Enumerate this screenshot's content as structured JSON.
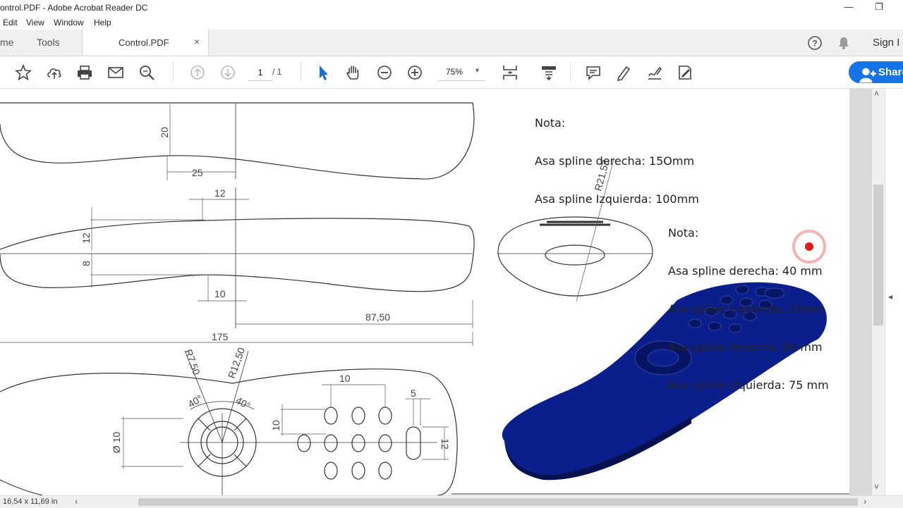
{
  "window": {
    "title": "ontrol.PDF - Adobe Acrobat Reader DC",
    "minimize_glyph": "—",
    "restore_glyph": "❐"
  },
  "menu": [
    "Edit",
    "View",
    "Window",
    "Help"
  ],
  "tabs": {
    "home": "me",
    "tools": "Tools",
    "document": "Control.PDF",
    "close_glyph": "×"
  },
  "header_right": {
    "sign_in": "Sign I"
  },
  "toolbar": {
    "page_current": "1",
    "page_total": "/ 1",
    "zoom": "75%",
    "zoom_caret": "▾",
    "share_label": "Share"
  },
  "icons": [
    "star-icon",
    "upload-cloud-icon",
    "print-icon",
    "mail-icon",
    "search-zoom-icon",
    "page-up-icon",
    "page-down-icon",
    "select-arrow-icon",
    "hand-icon",
    "zoom-out-icon",
    "zoom-in-icon",
    "fit-page-icon",
    "scroll-mode-icon",
    "comment-icon",
    "highlight-icon",
    "sign-icon",
    "edit-stamp-icon",
    "help-icon",
    "bell-icon",
    "add-user-icon"
  ],
  "drawing": {
    "note1": {
      "heading": "Nota:",
      "line1": "Asa spline derecha: 15Omm",
      "line2": "Asa spline Izquierda: 100mm"
    },
    "note2": {
      "heading": "Nota:",
      "line1": "Asa spline derecha: 40 mm",
      "line2": "Asa spline Izquierda: 20mm",
      "line3": "Asa spline derecha: 90 mm",
      "line4": "Asa spline Izquierda: 75 mm"
    },
    "dims": {
      "d20": "20",
      "d25": "25",
      "d12a": "12",
      "d12b": "12",
      "d8": "8",
      "d10a": "10",
      "d87": "87,50",
      "d175": "175",
      "r750": "R7,50",
      "r1250": "R12,50",
      "a40a": "40°",
      "a40b": "40°",
      "d10b": "10",
      "d5": "5",
      "d10c": "10",
      "d12c": "12",
      "dia10": "Ø 10",
      "r2153": "R21,53"
    },
    "model_color": "#0b1f8c"
  },
  "status": {
    "page_size": "16,54 x 11,69 in",
    "scroll_left": "‹",
    "scroll_right": "›",
    "scroll_up": "˄",
    "scroll_down": "˅",
    "pane_toggle": "◂"
  }
}
